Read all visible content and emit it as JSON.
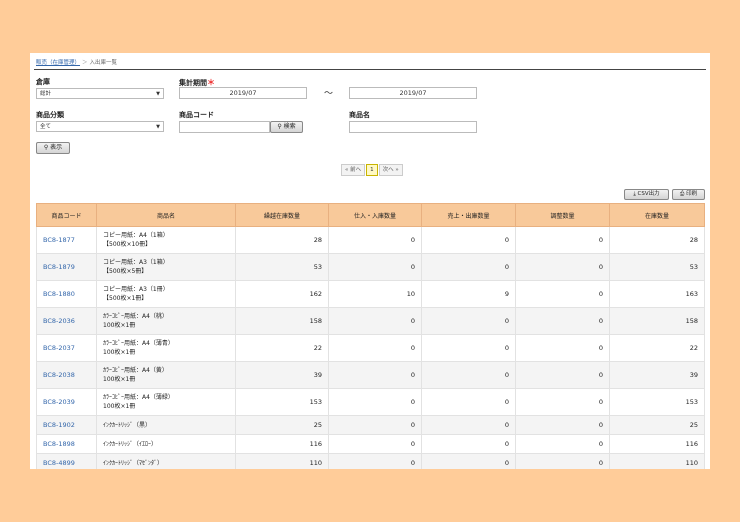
{
  "breadcrumb": {
    "parent": "販売（在庫管理）",
    "separator": "＞",
    "current": "入出庫一覧"
  },
  "form": {
    "warehouse_label": "倉庫",
    "warehouse_value": "総計",
    "period_label": "集計期間",
    "required_mark": "＊",
    "period_from": "2019/07",
    "period_sep": "〜",
    "period_to": "2019/07",
    "category_label": "商品分類",
    "category_value": "全て",
    "code_label": "商品コード",
    "code_value": "",
    "search_label": "検索",
    "name_label": "商品名",
    "name_value": "",
    "show_label": "表示"
  },
  "pager": {
    "prev": "« 前へ",
    "current": "1",
    "next": "次へ »"
  },
  "actions": {
    "csv": "CSV出力",
    "print": "印刷"
  },
  "table": {
    "headers": [
      "商品コード",
      "商品名",
      "繰越在庫数量",
      "仕入・入庫数量",
      "売上・出庫数量",
      "調整数量",
      "在庫数量"
    ],
    "rows": [
      {
        "code": "BC8-1877",
        "name1": "コピー用紙：A4（1箱）",
        "name2": "【500枚×10冊】",
        "carry": "28",
        "in": "0",
        "out": "0",
        "adj": "0",
        "stock": "28"
      },
      {
        "code": "BC8-1879",
        "name1": "コピー用紙：A3（1箱）",
        "name2": "【500枚×5冊】",
        "carry": "53",
        "in": "0",
        "out": "0",
        "adj": "0",
        "stock": "53"
      },
      {
        "code": "BC8-1880",
        "name1": "コピー用紙：A3（1冊）",
        "name2": "【500枚×1冊】",
        "carry": "162",
        "in": "10",
        "out": "9",
        "adj": "0",
        "stock": "163"
      },
      {
        "code": "BC8-2036",
        "name1": "ｶﾗｰｺﾋﾟｰ用紙：A4（桃）",
        "name2": "100枚×1冊",
        "carry": "158",
        "in": "0",
        "out": "0",
        "adj": "0",
        "stock": "158"
      },
      {
        "code": "BC8-2037",
        "name1": "ｶﾗｰｺﾋﾟｰ用紙：A4（薄青）",
        "name2": "100枚×1冊",
        "carry": "22",
        "in": "0",
        "out": "0",
        "adj": "0",
        "stock": "22"
      },
      {
        "code": "BC8-2038",
        "name1": "ｶﾗｰｺﾋﾟｰ用紙：A4（黄）",
        "name2": "100枚×1冊",
        "carry": "39",
        "in": "0",
        "out": "0",
        "adj": "0",
        "stock": "39"
      },
      {
        "code": "BC8-2039",
        "name1": "ｶﾗｰｺﾋﾟｰ用紙：A4（薄緑）",
        "name2": "100枚×1冊",
        "carry": "153",
        "in": "0",
        "out": "0",
        "adj": "0",
        "stock": "153"
      },
      {
        "code": "BC8-1902",
        "name1": "ｲﾝｸｶｰﾄﾘｯｼﾞ（黒）",
        "name2": "",
        "carry": "25",
        "in": "0",
        "out": "0",
        "adj": "0",
        "stock": "25"
      },
      {
        "code": "BC8-1898",
        "name1": "ｲﾝｸｶｰﾄﾘｯｼﾞ（ｲｴﾛｰ）",
        "name2": "",
        "carry": "116",
        "in": "0",
        "out": "0",
        "adj": "0",
        "stock": "116"
      },
      {
        "code": "BC8-4899",
        "name1": "ｲﾝｸｶｰﾄﾘｯｼﾞ（ﾏｾﾞﾝﾀﾞ）",
        "name2": "",
        "carry": "110",
        "in": "0",
        "out": "0",
        "adj": "0",
        "stock": "110"
      }
    ]
  }
}
